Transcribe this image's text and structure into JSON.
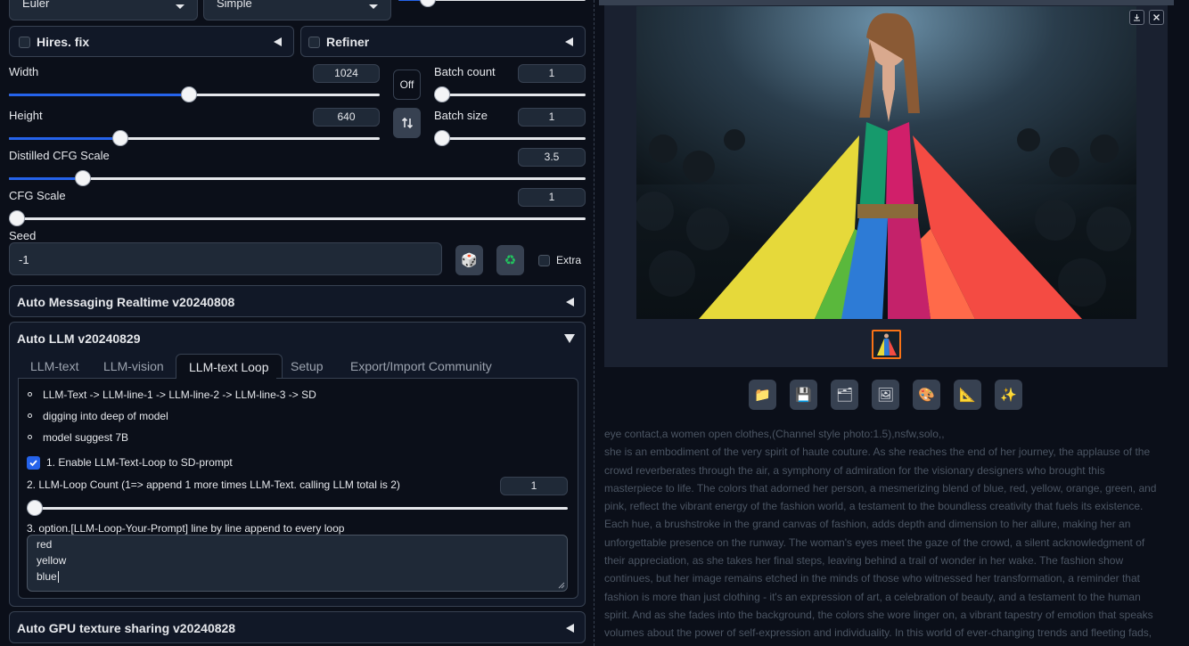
{
  "sampler": {
    "method": "Euler",
    "schedule": "Simple"
  },
  "hires": {
    "label": "Hires. fix",
    "checked": false
  },
  "refiner": {
    "label": "Refiner",
    "checked": false
  },
  "width": {
    "label": "Width",
    "value": "1024",
    "fraction": 0.47
  },
  "height": {
    "label": "Height",
    "value": "640",
    "fraction": 0.29
  },
  "swap_toggle": {
    "label": "Off"
  },
  "batch_count": {
    "label": "Batch count",
    "value": "1",
    "fraction": 0.0
  },
  "batch_size": {
    "label": "Batch size",
    "value": "1",
    "fraction": 0.0
  },
  "distilled_cfg": {
    "label": "Distilled CFG Scale",
    "value": "3.5",
    "fraction": 0.13
  },
  "cfg": {
    "label": "CFG Scale",
    "value": "1",
    "fraction": 0.0
  },
  "seed": {
    "label": "Seed",
    "value": "-1",
    "extra_label": "Extra"
  },
  "accordions": {
    "auto_messaging": "Auto Messaging Realtime v20240808",
    "auto_llm": "Auto LLM v20240829",
    "auto_gpu": "Auto GPU texture sharing v20240828"
  },
  "llm_tabs": [
    "LLM-text",
    "LLM-vision",
    "LLM-text Loop",
    "Setup",
    "Export/Import Community"
  ],
  "llm_loop": {
    "bullets": [
      "LLM-Text -> LLM-line-1 -> LLM-line-2 -> LLM-line-3 -> SD",
      "digging into deep of model",
      "model suggest 7B"
    ],
    "enable_label": "1. Enable LLM-Text-Loop to SD-prompt",
    "enable_checked": true,
    "count_label": "2. LLM-Loop Count (1=> append 1 more times LLM-Text. calling LLM total is 2)",
    "count_value": "1",
    "count_fraction": 0.0,
    "prompt_label": "3. option.[LLM-Loop-Your-Prompt] line by line append to every loop",
    "prompt_lines": [
      "red",
      "yellow",
      "blue"
    ]
  },
  "toolbar_icons": [
    "folder-icon",
    "save-icon",
    "zip-icon",
    "image-icon",
    "palette-icon",
    "ruler-icon",
    "sparkle-icon"
  ],
  "output": {
    "prompt_line": "eye contact,a women open clothes,(Channel style photo:1.5),nsfw,solo,,",
    "description": "she is an embodiment of the very spirit of haute couture. As she reaches the end of her journey, the applause of the crowd reverberates through the air, a symphony of admiration for the visionary designers who brought this masterpiece to life. The colors that adorned her person, a mesmerizing blend of blue, red, yellow, orange, green, and pink, reflect the vibrant energy of the fashion world, a testament to the boundless creativity that fuels its existence. Each hue, a brushstroke in the grand canvas of fashion, adds depth and dimension to her allure, making her an unforgettable presence on the runway. The woman's eyes meet the gaze of the crowd, a silent acknowledgment of their appreciation, as she takes her final steps, leaving behind a trail of wonder in her wake. The fashion show continues, but her image remains etched in the minds of those who witnessed her transformation, a reminder that fashion is more than just clothing - it's an expression of art, a celebration of beauty, and a testament to the human spirit. And as she fades into the background, the colors she wore linger on, a vibrant tapestry of emotion that speaks volumes about the power of self-expression and individuality. In this world of ever-changing trends and fleeting fads, she stands out as a beacon of"
  },
  "colors": {
    "accent": "#2563eb",
    "background": "#0b0f19",
    "panel": "#111827",
    "border": "#374151"
  }
}
